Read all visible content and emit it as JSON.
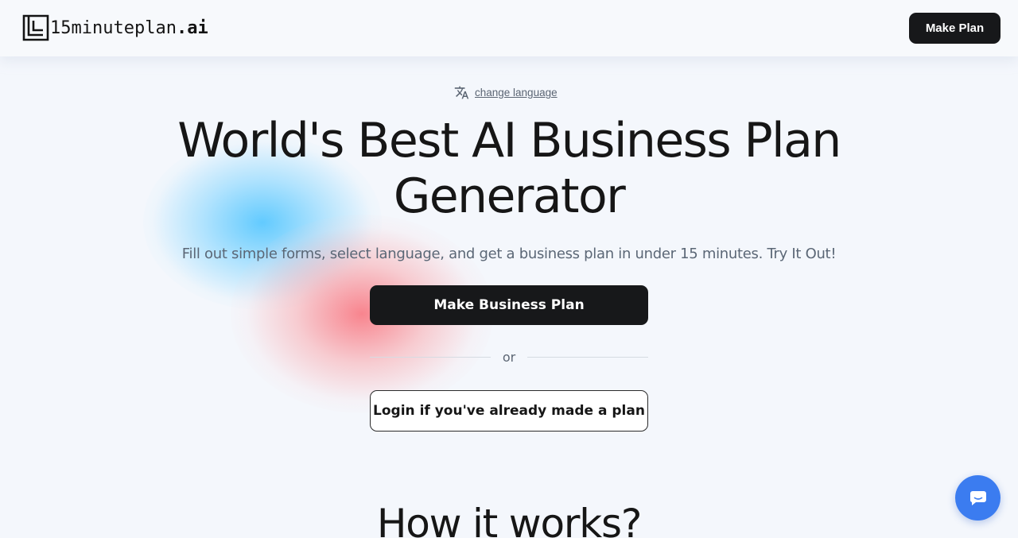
{
  "header": {
    "logo_text": "15minuteplan",
    "logo_suffix": ".ai",
    "make_plan_label": "Make Plan"
  },
  "hero": {
    "change_language_label": "change language",
    "title_line1": "World's Best AI Business Plan",
    "title_line2": "Generator",
    "subtitle": "Fill out simple forms, select language, and get a business plan in under 15 minutes. Try It Out!",
    "primary_button_label": "Make Business Plan",
    "divider_text": "or",
    "login_button_label": "Login if you've already made a plan"
  },
  "how_it_works": {
    "heading": "How it works?"
  },
  "icons": {
    "logo": "maze-logo-icon",
    "language": "translate-icon",
    "chat": "chat-bubble-icon"
  },
  "colors": {
    "background": "#f4f7fc",
    "primary_button": "#17181a",
    "chat_button": "#3b7cf0",
    "blob_blue": "#5ac8ff",
    "blob_red": "#f87882"
  }
}
